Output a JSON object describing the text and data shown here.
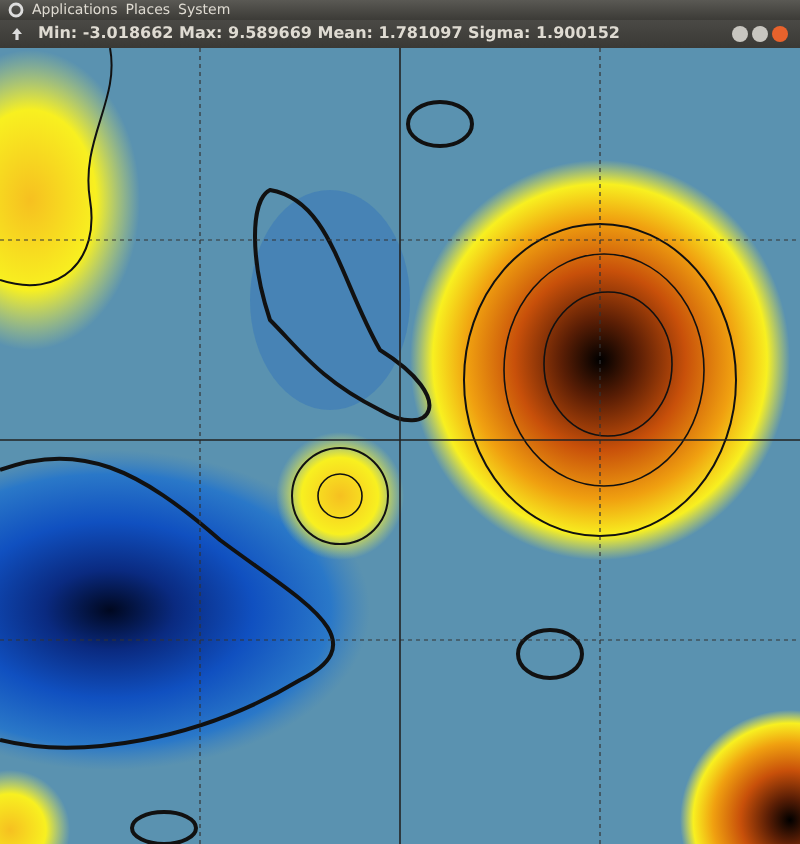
{
  "top_panel": {
    "menus": [
      "Applications",
      "Places",
      "System"
    ]
  },
  "window": {
    "title": "Min: -3.018662 Max: 9.589669 Mean: 1.781097 Sigma: 1.900152"
  }
}
